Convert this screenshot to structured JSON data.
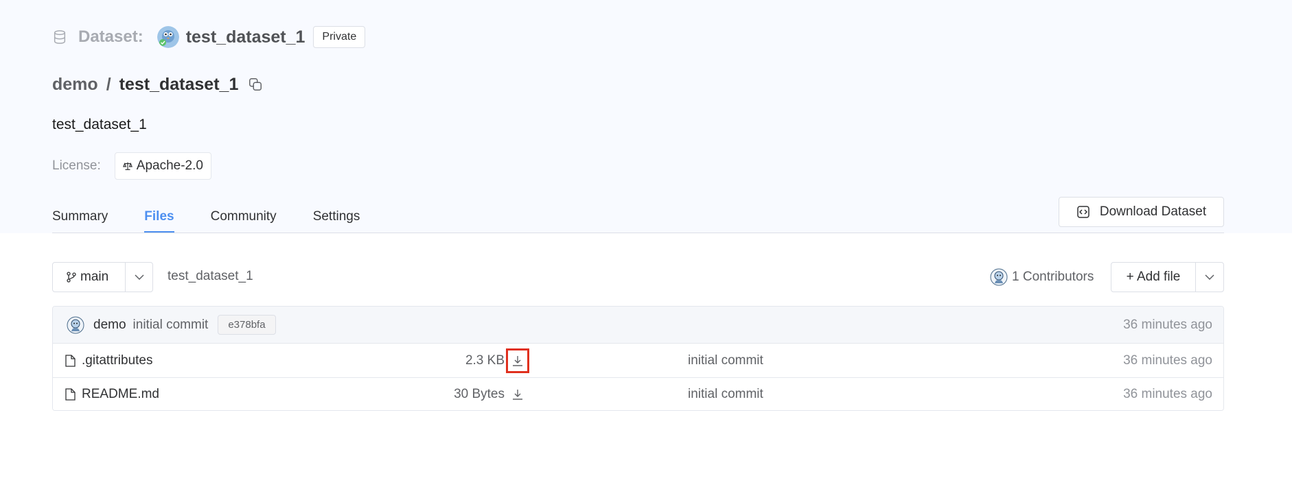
{
  "header": {
    "type_label": "Dataset:",
    "name": "test_dataset_1",
    "visibility": "Private"
  },
  "path": {
    "owner": "demo",
    "separator": "/",
    "repo": "test_dataset_1"
  },
  "description": "test_dataset_1",
  "license": {
    "label": "License:",
    "value": "Apache-2.0"
  },
  "tabs": [
    {
      "label": "Summary",
      "active": false
    },
    {
      "label": "Files",
      "active": true
    },
    {
      "label": "Community",
      "active": false
    },
    {
      "label": "Settings",
      "active": false
    }
  ],
  "download_button": "Download Dataset",
  "toolbar": {
    "branch": "main",
    "breadcrumb": "test_dataset_1",
    "contributors": "1 Contributors",
    "add_file": "+ Add file"
  },
  "last_commit": {
    "author": "demo",
    "message": "initial commit",
    "sha": "e378bfa",
    "time": "36 minutes ago"
  },
  "files": [
    {
      "name": ".gitattributes",
      "size": "2.3 KB",
      "commit": "initial commit",
      "time": "36 minutes ago",
      "highlighted": true
    },
    {
      "name": "README.md",
      "size": "30 Bytes",
      "commit": "initial commit",
      "time": "36 minutes ago",
      "highlighted": false
    }
  ],
  "colors": {
    "accent": "#4d8ff0",
    "highlight_box": "#e0301e",
    "header_bg": "#f8faff"
  }
}
